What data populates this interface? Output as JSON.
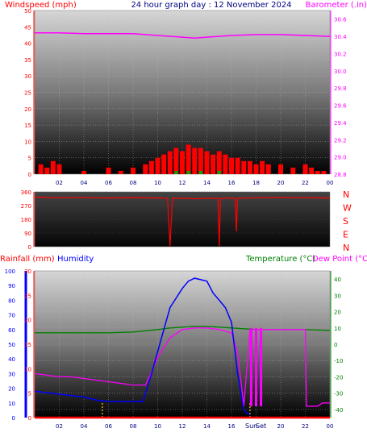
{
  "header": {
    "left_label": "Windspeed (mph)",
    "title": "24 hour graph day : 12 November 2024",
    "right_label": "Barometer (.in)"
  },
  "colors": {
    "windspeed": "#ff0000",
    "barometer": "#ff00ff",
    "wind_direction": "#ff0000",
    "rainfall": "#ff0000",
    "humidity": "#0000ff",
    "temperature": "#008000",
    "dew_point": "#ff00ff",
    "sun_marker": "#ffd000",
    "gust_marker": "#00aa00",
    "compass_letters": "#ff0000"
  },
  "compass": [
    "N",
    "W",
    "S",
    "E",
    "N"
  ],
  "lower_header": {
    "rain_label": "Rainfall (mm)",
    "humidity_label": "Humidity",
    "temp_label": "Temperature (°C)",
    "dew_label": "Dew Point (°C)"
  },
  "sun": {
    "rise_label": "Sun",
    "set_label": "Set"
  },
  "chart_data": [
    {
      "id": "wind_baro",
      "type": "bar",
      "title": "24 hour graph day : 12 November 2024",
      "x_ticks": [
        "02",
        "04",
        "06",
        "08",
        "10",
        "12",
        "14",
        "16",
        "18",
        "20",
        "22",
        "00"
      ],
      "x_range": [
        0,
        24
      ],
      "left_axis": {
        "label": "Windspeed (mph)",
        "ticks": [
          0,
          5,
          10,
          15,
          20,
          25,
          30,
          35,
          40,
          45,
          50
        ],
        "ylim": [
          0,
          50
        ]
      },
      "right_axis": {
        "label": "Barometer (.in)",
        "ticks": [
          28.8,
          29.0,
          29.2,
          29.4,
          29.6,
          29.8,
          30.0,
          30.2,
          30.4,
          30.6
        ],
        "ylim": [
          28.8,
          30.7
        ]
      },
      "series": [
        {
          "name": "Windspeed (mph)",
          "type": "bar",
          "axis": "left",
          "x": [
            0.5,
            1.0,
            1.5,
            2.0,
            3.0,
            4.0,
            5.0,
            6.0,
            7.0,
            8.0,
            9.0,
            9.5,
            10.0,
            10.5,
            11.0,
            11.5,
            12.0,
            12.5,
            13.0,
            13.5,
            14.0,
            14.5,
            15.0,
            15.5,
            16.0,
            16.5,
            17.0,
            17.5,
            18.0,
            18.5,
            19.0,
            20.0,
            21.0,
            22.0,
            22.5,
            23.0,
            23.5
          ],
          "values": [
            3,
            2,
            4,
            3,
            0,
            1,
            0,
            2,
            1,
            2,
            3,
            4,
            5,
            6,
            7,
            8,
            7,
            9,
            8,
            8,
            7,
            6,
            7,
            6,
            5,
            5,
            4,
            4,
            3,
            4,
            3,
            3,
            2,
            3,
            2,
            1,
            1
          ]
        },
        {
          "name": "Barometer (.in)",
          "type": "line",
          "axis": "right",
          "x": [
            0,
            2,
            4,
            6,
            8,
            10,
            12,
            13,
            14,
            16,
            18,
            20,
            22,
            24
          ],
          "values": [
            30.44,
            30.44,
            30.43,
            30.43,
            30.43,
            30.41,
            30.39,
            30.38,
            30.39,
            30.41,
            30.42,
            30.42,
            30.41,
            30.4
          ]
        }
      ]
    },
    {
      "id": "wind_direction",
      "type": "line",
      "x_range": [
        0,
        24
      ],
      "left_axis": {
        "ticks": [
          0,
          90,
          180,
          270,
          360
        ],
        "ylim": [
          0,
          360
        ]
      },
      "series": [
        {
          "name": "Wind direction",
          "x": [
            0,
            2,
            4,
            6,
            8,
            10,
            10.8,
            11.0,
            11.2,
            12,
            13,
            14,
            14.9,
            15.0,
            15.1,
            16,
            16.3,
            16.4,
            16.5,
            18,
            20,
            22,
            24
          ],
          "values": [
            325,
            322,
            324,
            320,
            323,
            320,
            318,
            5,
            318,
            318,
            315,
            318,
            318,
            5,
            318,
            320,
            318,
            100,
            318,
            322,
            324,
            322,
            320
          ]
        }
      ]
    },
    {
      "id": "temp_hum_rain",
      "type": "line",
      "x_range": [
        0,
        24
      ],
      "left_axis_humidity": {
        "label": "Humidity",
        "ticks": [
          0,
          10,
          20,
          30,
          40,
          50,
          60,
          70,
          80,
          90,
          100
        ],
        "ylim": [
          0,
          100
        ]
      },
      "left_axis_rain": {
        "label": "Rainfall (mm)",
        "ticks": [
          0,
          5,
          10,
          15,
          20,
          25,
          30
        ],
        "ylim": [
          0,
          30
        ]
      },
      "right_axis": {
        "label": "Temperature (°C)",
        "ticks": [
          -40,
          -30,
          -20,
          -10,
          0,
          10,
          20,
          30,
          40
        ],
        "ylim": [
          -45,
          45
        ]
      },
      "series": [
        {
          "name": "Humidity",
          "axis": "humidity",
          "x": [
            0,
            1,
            2,
            3,
            4,
            5,
            6,
            7,
            8,
            8.8,
            9.5,
            10,
            10.5,
            11,
            12,
            12.5,
            13,
            13.5,
            14,
            14.5,
            15,
            15.5,
            16,
            16.5,
            17,
            17.3,
            17.5
          ],
          "values": [
            18,
            17,
            16,
            15,
            14,
            12,
            11,
            11,
            11,
            11,
            30,
            45,
            60,
            75,
            88,
            93,
            95,
            94,
            93,
            85,
            80,
            75,
            65,
            30,
            5,
            3,
            2
          ]
        },
        {
          "name": "Temperature (°C)",
          "axis": "temperature",
          "x": [
            0,
            2,
            4,
            6,
            8,
            10,
            11,
            12,
            13,
            14,
            15,
            16,
            17,
            18,
            20,
            22,
            24
          ],
          "values": [
            7,
            7,
            7,
            7,
            7.5,
            9,
            10,
            10.5,
            11,
            11,
            10.5,
            10,
            9.5,
            9,
            9,
            9,
            8.5
          ]
        },
        {
          "name": "Dew Point (°C)",
          "axis": "temperature",
          "x": [
            0,
            1,
            2,
            3,
            4,
            5,
            6,
            7,
            8,
            9,
            9.5,
            10,
            11,
            12,
            13,
            14,
            15,
            16,
            16.5,
            17,
            17.5,
            18,
            19,
            20,
            21,
            22,
            22.1,
            23,
            23.4,
            24
          ],
          "values": [
            -18,
            -19,
            -20,
            -20,
            -21,
            -22,
            -23,
            -24,
            -25,
            -25,
            -17,
            -8,
            4,
            9,
            10,
            10,
            9,
            7,
            -5,
            -38,
            9,
            9,
            9,
            9,
            9,
            9,
            -38,
            -38,
            -36,
            -36
          ]
        },
        {
          "name": "Rainfall (mm)",
          "axis": "rain",
          "x": [
            0,
            24
          ],
          "values": [
            0,
            0
          ]
        }
      ],
      "sunrise_hour": 5.5,
      "sunset_hour": 17.5
    }
  ]
}
